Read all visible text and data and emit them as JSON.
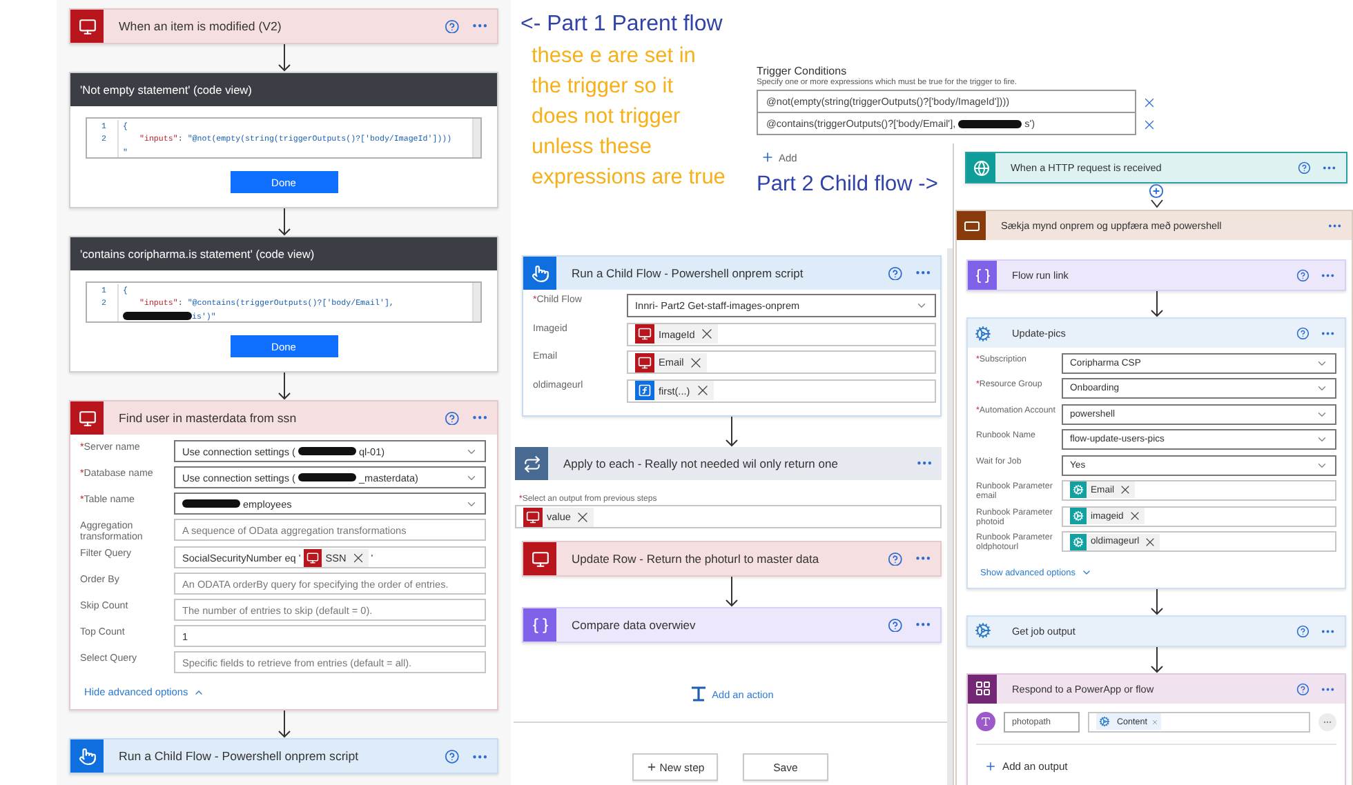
{
  "left_flow": {
    "steps": [
      {
        "kind": "sql",
        "title": "When an item is modified (V2)",
        "help": true,
        "menu": true
      },
      {
        "kind": "code",
        "title": "'Not empty statement' (code view)",
        "button": "Done",
        "code": [
          {
            "number": "1",
            "parts": [
              {
                "kind": "text",
                "text": "{"
              }
            ]
          },
          {
            "number": "2",
            "parts": [
              {
                "kind": "key",
                "text": "\"inputs\""
              },
              {
                "kind": "plain",
                "text": ": "
              },
              {
                "kind": "text",
                "text": "\"@not(empty(string(triggerOutputs()?['body/ImageId'])))"
              }
            ]
          },
          {
            "parts": [
              {
                "kind": "text",
                "text": "\""
              }
            ]
          }
        ]
      },
      {
        "kind": "code",
        "title": "'contains coripharma.is statement' (code view)",
        "button": "Done",
        "code": [
          {
            "number": "1",
            "parts": [
              {
                "kind": "text",
                "text": "{"
              }
            ]
          },
          {
            "number": "2",
            "parts": [
              {
                "kind": "key",
                "text": "\"inputs\""
              },
              {
                "kind": "plain",
                "text": ": "
              },
              {
                "kind": "text",
                "text": "\"@contains(triggerOutputs()?['body/Email'],"
              }
            ]
          },
          {
            "parts": [
              {
                "kind": "redacted"
              },
              {
                "kind": "text",
                "text": "is')\""
              }
            ]
          }
        ]
      },
      {
        "kind": "sql",
        "title": "Find user in masterdata from ssn",
        "help": true,
        "menu": true,
        "fields": [
          {
            "kind": "dropdown",
            "label": "Server name",
            "mark": "*",
            "parts": [
              {
                "kind": "text",
                "text": "Use connection settings ("
              },
              {
                "kind": "redacted"
              },
              {
                "kind": "text",
                "text": "ql-01)"
              }
            ]
          },
          {
            "kind": "dropdown",
            "label": "Database name",
            "mark": "*",
            "parts": [
              {
                "kind": "text",
                "text": "Use connection settings ("
              },
              {
                "kind": "redacted"
              },
              {
                "kind": "text",
                "text": "_masterdata)"
              }
            ]
          },
          {
            "kind": "dropdown",
            "label": "Table name",
            "mark": "*",
            "parts": [
              {
                "kind": "redacted"
              },
              {
                "kind": "text",
                "text": "employees"
              }
            ]
          },
          {
            "kind": "text",
            "label": "Aggregation transformation",
            "placeholder": "A sequence of OData aggregation transformations"
          },
          {
            "kind": "text",
            "label": "Filter Query",
            "parts": [
              {
                "kind": "text",
                "text": "SocialSecurityNumber eq '"
              },
              {
                "kind": "sql_token",
                "text": "SSN"
              },
              {
                "kind": "text",
                "text": "'"
              }
            ]
          },
          {
            "kind": "text",
            "label": "Order By",
            "placeholder": "An ODATA orderBy query for specifying the order of entries."
          },
          {
            "kind": "text",
            "label": "Skip Count",
            "placeholder": "The number of entries to skip (default = 0)."
          },
          {
            "kind": "text",
            "label": "Top Count",
            "parts": [
              {
                "kind": "text",
                "text": "1"
              }
            ]
          },
          {
            "kind": "text",
            "label": "Select Query",
            "placeholder": "Specific fields to retrieve from entries (default = all)."
          }
        ],
        "link": {
          "text": "Hide advanced options",
          "expanded": true
        }
      },
      {
        "kind": "child",
        "title": "Run a Child Flow - Powershell onprem script",
        "help": true,
        "menu": true
      }
    ]
  },
  "annotation": {
    "heading": "<- Part 1 Parent flow",
    "note_lines": [
      "these e are set in",
      "the trigger so it",
      "does not trigger",
      "unless these",
      "expressions are true"
    ]
  },
  "trigger_conditions": {
    "title": "Trigger Conditions",
    "description": "Specify one or more expressions which must be true for the trigger to fire.",
    "conditions": [
      {
        "parts": [
          {
            "kind": "text",
            "text": "@not(empty(string(triggerOutputs()?['body/ImageId'])))"
          }
        ]
      },
      {
        "parts": [
          {
            "kind": "text",
            "text": "@contains(triggerOutputs()?['body/Email'],"
          },
          {
            "kind": "redacted"
          },
          {
            "kind": "text",
            "text": "s')"
          }
        ]
      }
    ],
    "add_label": "Add"
  },
  "child_annotation": "Part 2 Child flow ->",
  "middle_flow": {
    "steps": [
      {
        "kind": "child",
        "title": "Run a Child Flow - Powershell onprem script",
        "help": true,
        "menu": true,
        "fields": [
          {
            "kind": "dropdown",
            "label": "Child Flow",
            "mark": "*",
            "parts": [
              {
                "kind": "text",
                "text": "Innri- Part2 Get-staff-images-onprem"
              }
            ]
          },
          {
            "kind": "text",
            "label": "Imageid",
            "parts": [
              {
                "kind": "sql_token",
                "text": "ImageId"
              }
            ]
          },
          {
            "kind": "text",
            "label": "Email",
            "parts": [
              {
                "kind": "sql_token",
                "text": "Email"
              }
            ]
          },
          {
            "kind": "text",
            "label": "oldimageurl",
            "parts": [
              {
                "kind": "expression_token",
                "text": "first(...)"
              }
            ]
          }
        ]
      },
      {
        "kind": "loop",
        "title": "Apply to each - Really not needed wil only return one",
        "menu": true,
        "select": {
          "label": "Select an output from previous steps",
          "mark": "*",
          "parts": [
            {
              "kind": "sql_token",
              "text": "value"
            }
          ]
        },
        "children": [
          {
            "kind": "sql",
            "title": "Update Row - Return the photurl to master data",
            "help": true,
            "menu": true
          },
          {
            "kind": "variable",
            "title": "Compare data overwiev",
            "help": true,
            "menu": true
          }
        ]
      }
    ],
    "add_action": "Add an action",
    "buttons": [
      {
        "kind": "new",
        "label": "New step"
      },
      {
        "kind": "save",
        "label": "Save"
      }
    ]
  },
  "child_flow": {
    "steps": [
      {
        "kind": "http",
        "title": "When a HTTP request is received",
        "help": true,
        "menu": true
      },
      {
        "kind": "scope",
        "title": "Sækja mynd onprem og uppfæra með powershell",
        "menu": true,
        "children": [
          {
            "kind": "variable",
            "title": "Flow run link",
            "help": true,
            "menu": true
          },
          {
            "kind": "automation",
            "title": "Update-pics",
            "help": true,
            "menu": true,
            "fields": [
              {
                "kind": "dropdown",
                "label": "Subscription",
                "mark": "*",
                "parts": [
                  {
                    "kind": "text",
                    "text": "Coripharma CSP"
                  }
                ]
              },
              {
                "kind": "dropdown",
                "label": "Resource Group",
                "mark": "*",
                "parts": [
                  {
                    "kind": "text",
                    "text": "Onboarding"
                  }
                ]
              },
              {
                "kind": "dropdown",
                "label": "Automation Account",
                "mark": "*",
                "parts": [
                  {
                    "kind": "text",
                    "text": "powershell"
                  }
                ]
              },
              {
                "kind": "dropdown",
                "label": "Runbook Name",
                "parts": [
                  {
                    "kind": "text",
                    "text": "flow-update-users-pics"
                  }
                ]
              },
              {
                "kind": "dropdown",
                "label": "Wait for Job",
                "parts": [
                  {
                    "kind": "text",
                    "text": "Yes"
                  }
                ]
              },
              {
                "kind": "text",
                "label": "Runbook Parameter email",
                "parts": [
                  {
                    "kind": "automation_token",
                    "text": "Email"
                  }
                ]
              },
              {
                "kind": "text",
                "label": "Runbook Parameter photoid",
                "parts": [
                  {
                    "kind": "automation_token",
                    "text": "imageid"
                  }
                ]
              },
              {
                "kind": "text",
                "label": "Runbook Parameter oldphotourl",
                "parts": [
                  {
                    "kind": "automation_token",
                    "text": "oldimageurl"
                  }
                ]
              }
            ],
            "link": {
              "text": "Show advanced options",
              "expanded": false
            }
          },
          {
            "kind": "automation",
            "title": "Get job output",
            "help": true,
            "menu": true
          },
          {
            "kind": "powerapp",
            "title": "Respond to a PowerApp or flow",
            "help": true,
            "menu": true,
            "outputs": [
              {
                "name": "photopath",
                "parts": [
                  {
                    "kind": "output_token",
                    "text": "Content"
                  }
                ]
              }
            ],
            "add_output": "Add an output"
          }
        ]
      }
    ]
  }
}
